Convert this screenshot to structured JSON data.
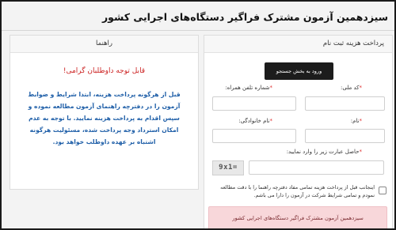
{
  "page": {
    "title": "سیزدهمین آزمون مشترک فراگیر دستگاه‌های اجرایی کشور"
  },
  "payment_panel": {
    "title": "پرداخت هزینه ثبت نام",
    "search_button": "ورود به بخش جستجو",
    "fields": {
      "national_id_label": "کد ملی:",
      "mobile_label": "شماره تلفن همراه:",
      "first_name_label": "نام:",
      "last_name_label": "نام خانوادگی:",
      "captcha_label": "حاصل عبارت زیر را وارد نمایید:"
    },
    "captcha_text": "9x1=",
    "agree_text": "اینجانب قبل از پرداخت هزینه تمامی مفاد دفترچه راهنما را با دقت مطالعه نمودم و تمامی شرایط شرکت در آزمون را دارا می باشم.",
    "alert_text": "سیزدهمین آزمون مشترک فراگیر دستگاه‌های اجرایی کشور"
  },
  "guide_panel": {
    "title": "راهنما",
    "heading": "قابل توجه داوطلبان گرامی!",
    "body": "قبل از هرگونه پرداخت هزینه، ابتدا شرایط و ضوابط آزمون را در دفترچه راهنمای آزمون مطالعه نموده و سپس اقدام به پرداخت هزینه نمایید. با توجه به عدم امکان استرداد وجه پرداخت شده، مسئولیت هرگونه اشتباه بر عهده داوطلب خواهد بود."
  },
  "colors": {
    "required_mark": "#e03030",
    "guide_heading": "#cc2222",
    "guide_body": "#1f5fa8",
    "alert_bg": "#f8d7da"
  }
}
